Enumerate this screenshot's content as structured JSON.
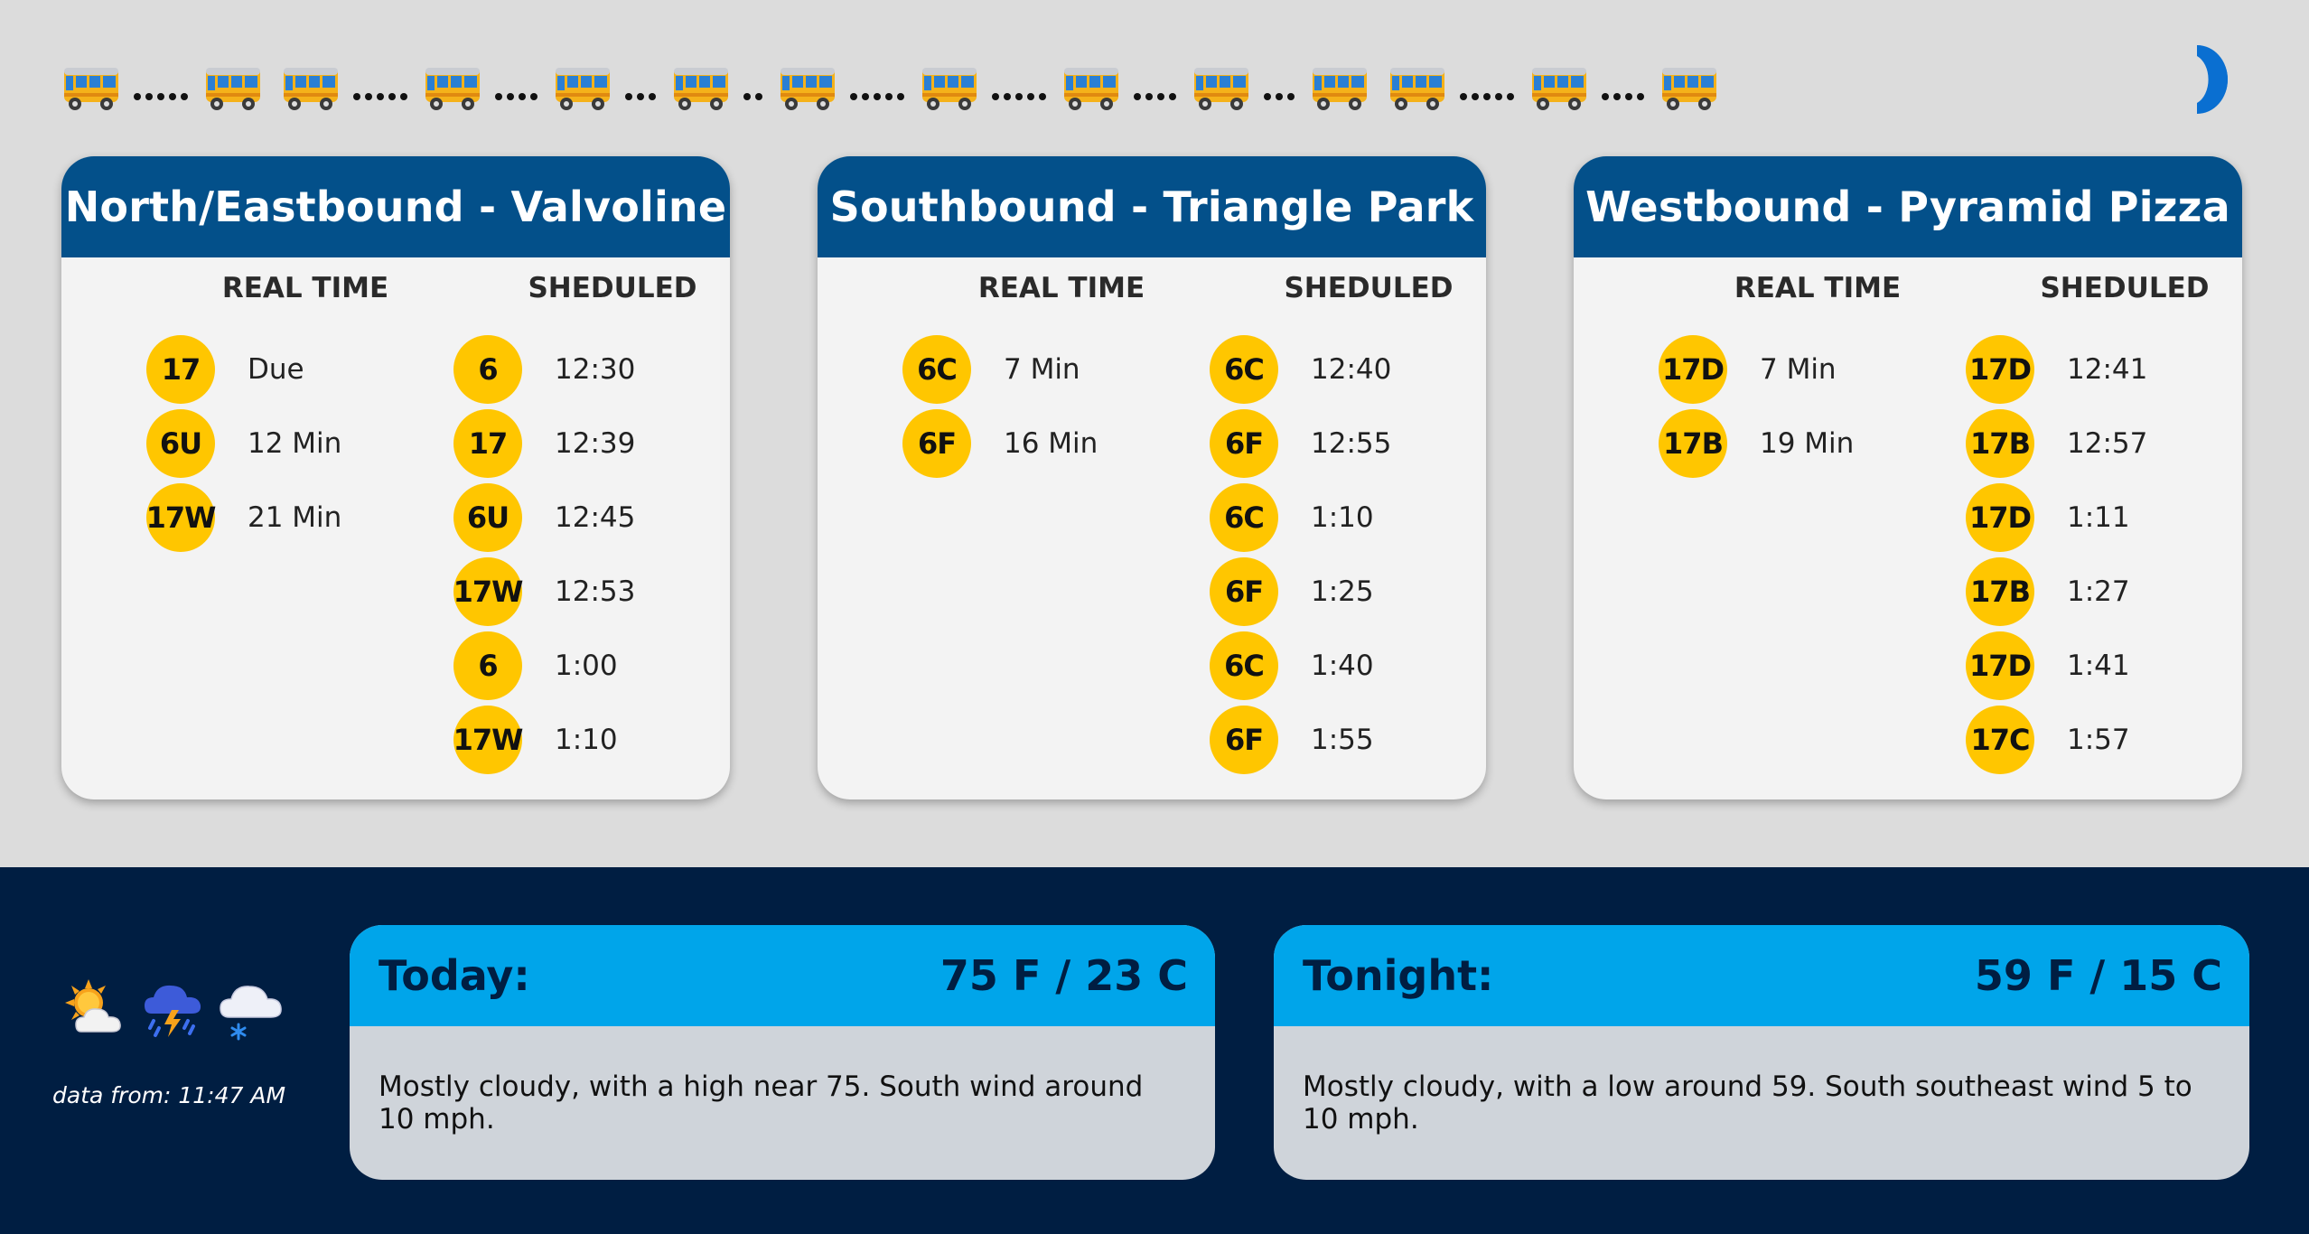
{
  "ticker": {
    "pattern": [
      {
        "bus": "bus-icon",
        "dots": 5
      },
      {
        "bus": "bus-icon",
        "dots": 0
      },
      {
        "bus": "bus-icon",
        "dots": 5
      },
      {
        "bus": "bus-icon",
        "dots": 4
      },
      {
        "bus": "bus-icon",
        "dots": 3
      },
      {
        "bus": "bus-icon",
        "dots": 2
      },
      {
        "bus": "bus-icon",
        "dots": 5
      },
      {
        "bus": "bus-icon",
        "dots": 5
      },
      {
        "bus": "bus-icon",
        "dots": 4
      },
      {
        "bus": "bus-icon",
        "dots": 3
      },
      {
        "bus": "bus-icon",
        "dots": 0
      },
      {
        "bus": "bus-icon",
        "dots": 5
      },
      {
        "bus": "bus-icon",
        "dots": 4
      },
      {
        "bus": "bus-icon",
        "dots": 0
      }
    ]
  },
  "panels": [
    {
      "title": "North/Eastbound - Valvoline",
      "realtime_label": "REAL TIME",
      "scheduled_label": "SHEDULED",
      "realtime": [
        {
          "route": "17",
          "time": "Due"
        },
        {
          "route": "6U",
          "time": "12 Min"
        },
        {
          "route": "17W",
          "time": "21 Min"
        }
      ],
      "scheduled": [
        {
          "route": "6",
          "time": "12:30"
        },
        {
          "route": "17",
          "time": "12:39"
        },
        {
          "route": "6U",
          "time": "12:45"
        },
        {
          "route": "17W",
          "time": "12:53"
        },
        {
          "route": "6",
          "time": "1:00"
        },
        {
          "route": "17W",
          "time": "1:10"
        }
      ]
    },
    {
      "title": "Southbound - Triangle Park",
      "realtime_label": "REAL TIME",
      "scheduled_label": "SHEDULED",
      "realtime": [
        {
          "route": "6C",
          "time": "7 Min"
        },
        {
          "route": "6F",
          "time": "16 Min"
        }
      ],
      "scheduled": [
        {
          "route": "6C",
          "time": "12:40"
        },
        {
          "route": "6F",
          "time": "12:55"
        },
        {
          "route": "6C",
          "time": "1:10"
        },
        {
          "route": "6F",
          "time": "1:25"
        },
        {
          "route": "6C",
          "time": "1:40"
        },
        {
          "route": "6F",
          "time": "1:55"
        }
      ]
    },
    {
      "title": "Westbound - Pyramid Pizza",
      "realtime_label": "REAL TIME",
      "scheduled_label": "SHEDULED",
      "realtime": [
        {
          "route": "17D",
          "time": "7 Min"
        },
        {
          "route": "17B",
          "time": "19 Min"
        }
      ],
      "scheduled": [
        {
          "route": "17D",
          "time": "12:41"
        },
        {
          "route": "17B",
          "time": "12:57"
        },
        {
          "route": "17D",
          "time": "1:11"
        },
        {
          "route": "17B",
          "time": "1:27"
        },
        {
          "route": "17D",
          "time": "1:41"
        },
        {
          "route": "17C",
          "time": "1:57"
        }
      ]
    }
  ],
  "weather": {
    "icons": [
      "sun-behind-cloud-icon",
      "thunder-rain-cloud-icon",
      "snow-cloud-icon"
    ],
    "data_from": "data from: 11:47 AM",
    "today": {
      "label": "Today:",
      "temp": "75 F / 23 C",
      "forecast": "Mostly cloudy, with a high near 75. South wind around 10 mph."
    },
    "tonight": {
      "label": "Tonight:",
      "temp": "59 F / 15 C",
      "forecast": "Mostly cloudy, with a low around 59. South southeast wind 5 to 10 mph."
    }
  },
  "colors": {
    "panel_header": "#03508a",
    "badge": "#ffc600",
    "weather_header": "#00a5ea",
    "footer_bg": "#001e42",
    "loader": "#0a6fd1"
  }
}
